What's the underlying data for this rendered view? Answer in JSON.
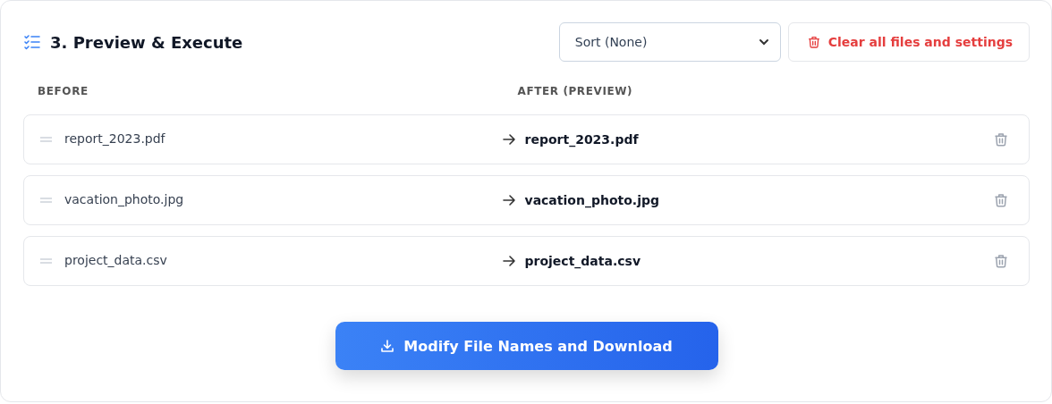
{
  "section": {
    "title": "3. Preview & Execute"
  },
  "sort_select": {
    "value": "Sort (None)"
  },
  "clear_button": {
    "label": "Clear all files and settings"
  },
  "columns": [
    "BEFORE",
    "AFTER (PREVIEW)"
  ],
  "files": [
    {
      "before": "report_2023.pdf",
      "after": "report_2023.pdf"
    },
    {
      "before": "vacation_photo.jpg",
      "after": "vacation_photo.jpg"
    },
    {
      "before": "project_data.csv",
      "after": "project_data.csv"
    }
  ],
  "action_button": {
    "label": "Modify File Names and Download"
  }
}
